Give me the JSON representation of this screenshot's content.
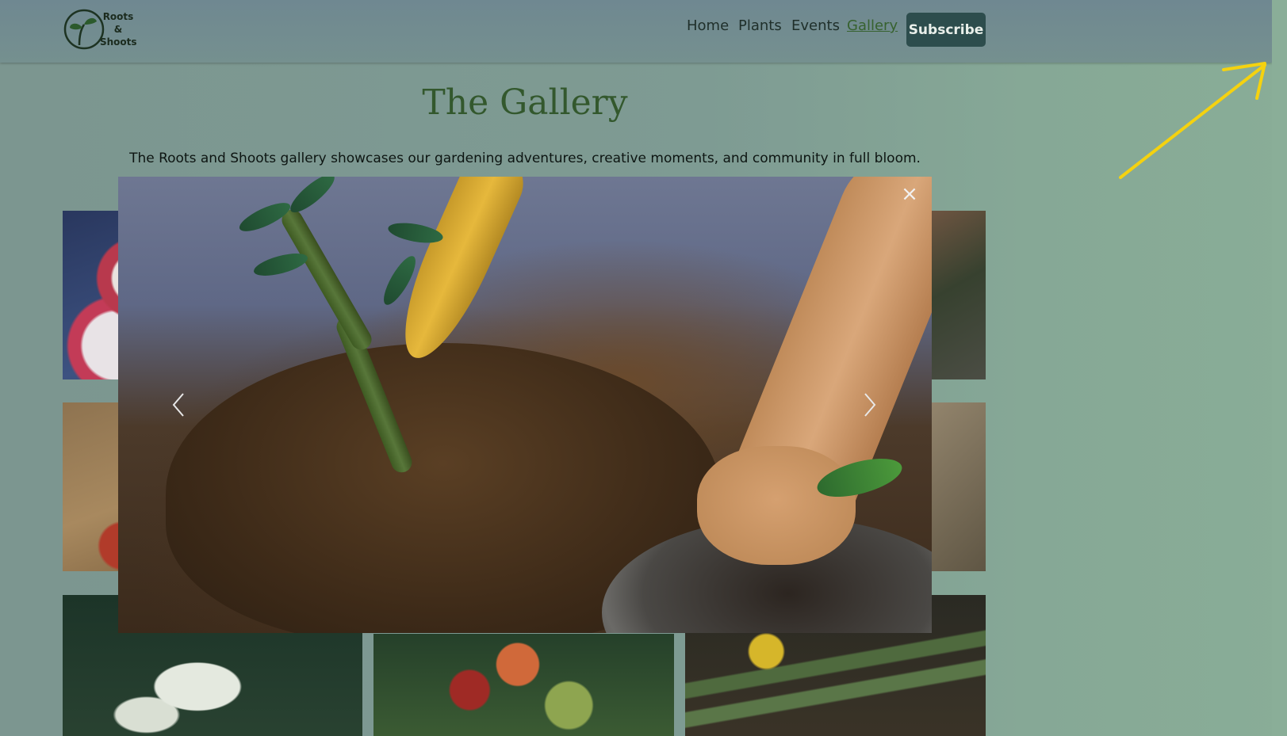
{
  "brand": {
    "logo_lines": [
      "Roots",
      "&",
      "Shoots"
    ]
  },
  "nav": {
    "items": [
      {
        "label": "Home",
        "active": false
      },
      {
        "label": "Plants",
        "active": false
      },
      {
        "label": "Events",
        "active": false
      },
      {
        "label": "Gallery",
        "active": true
      }
    ],
    "subscribe_label": "Subscribe"
  },
  "page": {
    "title": "The Gallery",
    "intro": "The Roots and Shoots gallery showcases our gardening adventures, creative moments, and community in full bloom."
  },
  "lightbox": {
    "close_icon": "close-icon",
    "prev_icon": "chevron-left-icon",
    "next_icon": "chevron-right-icon"
  },
  "colors": {
    "brand_green": "#33582d",
    "subscribe_bg": "#2d4d4d",
    "annotation_arrow": "#f5d20f"
  }
}
